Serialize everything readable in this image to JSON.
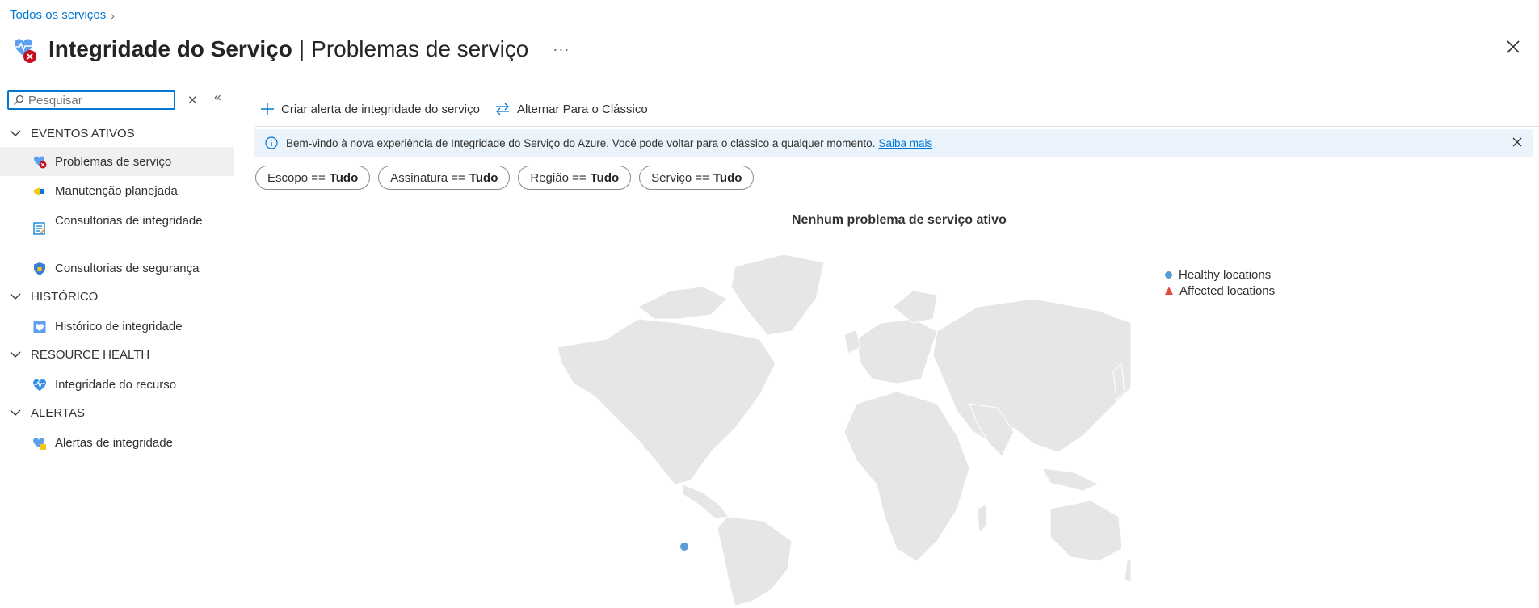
{
  "breadcrumb": {
    "root": "Todos os serviços"
  },
  "header": {
    "title": "Integridade do Serviço",
    "separator": "|",
    "subtitle": "Problemas de serviço",
    "more": "···"
  },
  "sidebar": {
    "search_placeholder": "Pesquisar",
    "groups": [
      {
        "label": "EVENTOS ATIVOS",
        "items": [
          {
            "label": "Problemas de serviço",
            "icon": "service-issues-icon",
            "active": true
          },
          {
            "label": "Manutenção planejada",
            "icon": "megaphone-icon"
          },
          {
            "label": "Consultorias de integridade",
            "icon": "advisory-icon"
          },
          {
            "label": "Consultorias de segurança",
            "icon": "shield-icon"
          }
        ]
      },
      {
        "label": "HISTÓRICO",
        "items": [
          {
            "label": "Histórico de integridade",
            "icon": "history-icon"
          }
        ]
      },
      {
        "label": "RESOURCE HEALTH",
        "items": [
          {
            "label": "Integridade do recurso",
            "icon": "heart-pulse-icon"
          }
        ]
      },
      {
        "label": "ALERTAS",
        "items": [
          {
            "label": "Alertas de integridade",
            "icon": "health-alert-icon"
          }
        ]
      }
    ]
  },
  "toolbar": {
    "create_alert": "Criar alerta de integridade do serviço",
    "switch_classic": "Alternar Para o Clássico"
  },
  "banner": {
    "text": "Bem-vindo à nova experiência de Integridade do Serviço do Azure. Você pode voltar para o clássico a qualquer momento.",
    "link": "Saiba mais"
  },
  "filters": [
    {
      "key": "Escopo ==",
      "value": "Tudo"
    },
    {
      "key": "Assinatura ==",
      "value": "Tudo"
    },
    {
      "key": "Região ==",
      "value": "Tudo"
    },
    {
      "key": "Serviço ==",
      "value": "Tudo"
    }
  ],
  "map": {
    "title": "Nenhum problema de serviço ativo",
    "legend": [
      {
        "label": "Healthy locations",
        "color": "#5b9bd5"
      },
      {
        "label": "Affected locations",
        "color": "#e04a3a"
      }
    ]
  },
  "colors": {
    "accent": "#0078d4",
    "banner_bg": "#ebf3fc",
    "land": "#e6e6e6"
  }
}
